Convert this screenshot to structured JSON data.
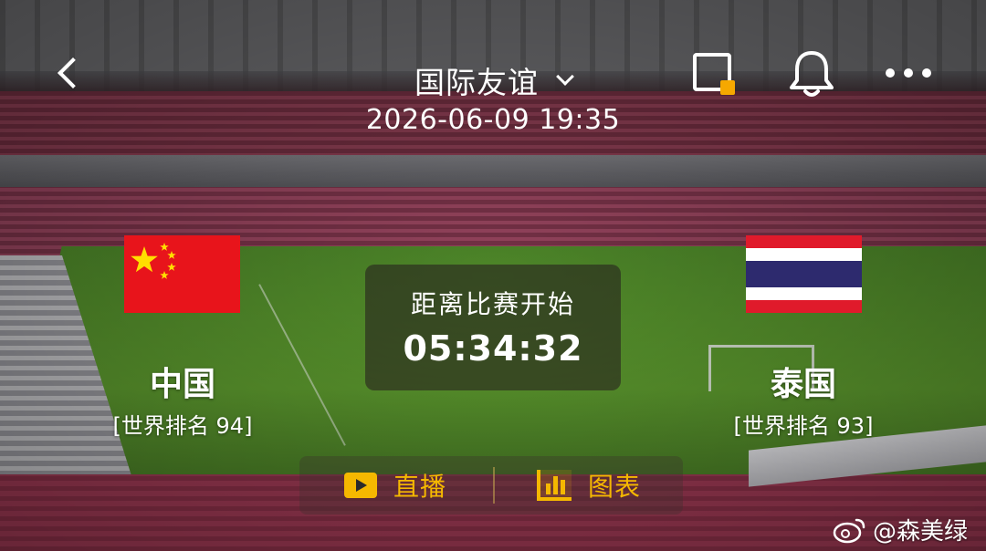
{
  "header": {
    "title": "国际友谊",
    "datetime": "2026-06-09 19:35"
  },
  "icons": {
    "back": "chevron-left-icon",
    "title_dropdown": "chevron-down-icon",
    "pip": "picture-in-picture-icon",
    "notify": "bell-icon",
    "more": "more-dots-icon"
  },
  "colors": {
    "accent": "#f5b800",
    "pip_dot": "#f6a800",
    "china_red": "#e8141b",
    "china_star": "#ffde00",
    "thai_red": "#e01a2b",
    "thai_blue": "#2d2a6e"
  },
  "match": {
    "home": {
      "name": "中国",
      "rank_text": "[世界排名 94]",
      "flag": "china-flag"
    },
    "away": {
      "name": "泰国",
      "rank_text": "[世界排名 93]",
      "flag": "thailand-flag"
    },
    "countdown_label": "距离比赛开始",
    "countdown_time": "05:34:32"
  },
  "actions": {
    "live_label": "直播",
    "chart_label": "图表"
  },
  "watermark": {
    "text": "@森美绿"
  }
}
